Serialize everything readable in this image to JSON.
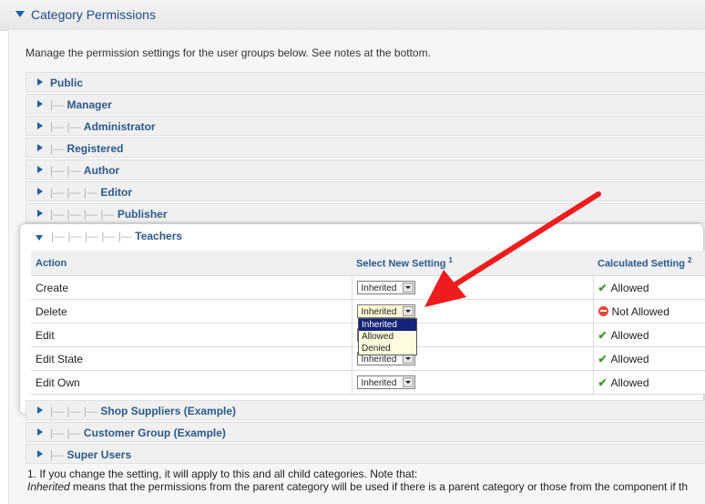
{
  "panel": {
    "title": "Category Permissions"
  },
  "intro": "Manage the permission settings for the user groups below. See notes at the bottom.",
  "groups_above": [
    {
      "tree": "",
      "label": "Public"
    },
    {
      "tree": "|— ",
      "label": "Manager"
    },
    {
      "tree": "|— |— ",
      "label": "Administrator"
    },
    {
      "tree": "|— ",
      "label": "Registered"
    },
    {
      "tree": "|— |— ",
      "label": "Author"
    },
    {
      "tree": "|— |— |— ",
      "label": "Editor"
    },
    {
      "tree": "|— |— |— |— ",
      "label": "Publisher"
    }
  ],
  "expanded_group": {
    "tree": "|— |— |— |— |— ",
    "label": "Teachers"
  },
  "table": {
    "headers": {
      "action": "Action",
      "select": "Select New Setting",
      "select_sup": "1",
      "calc": "Calculated Setting",
      "calc_sup": "2"
    },
    "rows": [
      {
        "action": "Create",
        "setting": "Inherited",
        "calc": "Allowed",
        "calc_status": "allowed"
      },
      {
        "action": "Delete",
        "setting": "Inherited",
        "calc": "Not Allowed",
        "calc_status": "denied"
      },
      {
        "action": "Edit",
        "setting": "Inherited",
        "calc": "Allowed",
        "calc_status": "allowed"
      },
      {
        "action": "Edit State",
        "setting": "Inherited",
        "calc": "Allowed",
        "calc_status": "allowed"
      },
      {
        "action": "Edit Own",
        "setting": "Inherited",
        "calc": "Allowed",
        "calc_status": "allowed"
      }
    ]
  },
  "dropdown": {
    "options": [
      "Inherited",
      "Allowed",
      "Denied"
    ],
    "highlighted": "Inherited"
  },
  "groups_below": [
    {
      "tree": "|— |— |— ",
      "label": "Shop Suppliers (Example)"
    },
    {
      "tree": "|— |— ",
      "label": "Customer Group (Example)"
    },
    {
      "tree": "|— ",
      "label": "Super Users"
    }
  ],
  "notes": {
    "line1": "1. If you change the setting, it will apply to this and all child categories. Note that:",
    "line2_em": "Inherited",
    "line2_rest": " means that the permissions from the parent category will be used if there is a parent category or those from the component if th"
  },
  "colors": {
    "link_blue": "#2b5a8a",
    "arrow_red": "#ee1c1c",
    "dropdown_highlight": "#14237a"
  }
}
